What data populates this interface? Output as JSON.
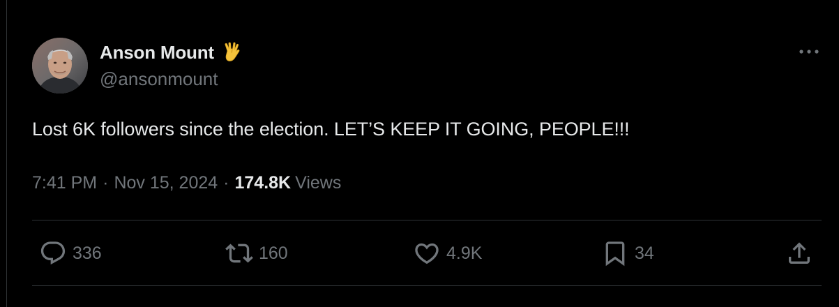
{
  "author": {
    "display_name": "Anson Mount",
    "handle": "@ansonmount",
    "name_emoji": "vulcan-salute-emoji"
  },
  "tweet": {
    "text": "Lost 6K followers since the election. LET’S KEEP IT GOING, PEOPLE!!!",
    "time": "7:41 PM",
    "separator": "·",
    "date": "Nov 15, 2024",
    "views_count": "174.8K",
    "views_label": "Views"
  },
  "actions": {
    "replies": "336",
    "reposts": "160",
    "likes": "4.9K",
    "bookmarks": "34"
  },
  "icons": {
    "reply": "reply-icon",
    "repost": "repost-icon",
    "like": "heart-icon",
    "bookmark": "bookmark-icon",
    "share": "share-icon",
    "more": "more-icon"
  },
  "colors": {
    "background": "#000000",
    "primary_text": "#e7e9ea",
    "secondary_text": "#71767b",
    "divider": "#2f3336",
    "emoji": "#f5c33b"
  }
}
